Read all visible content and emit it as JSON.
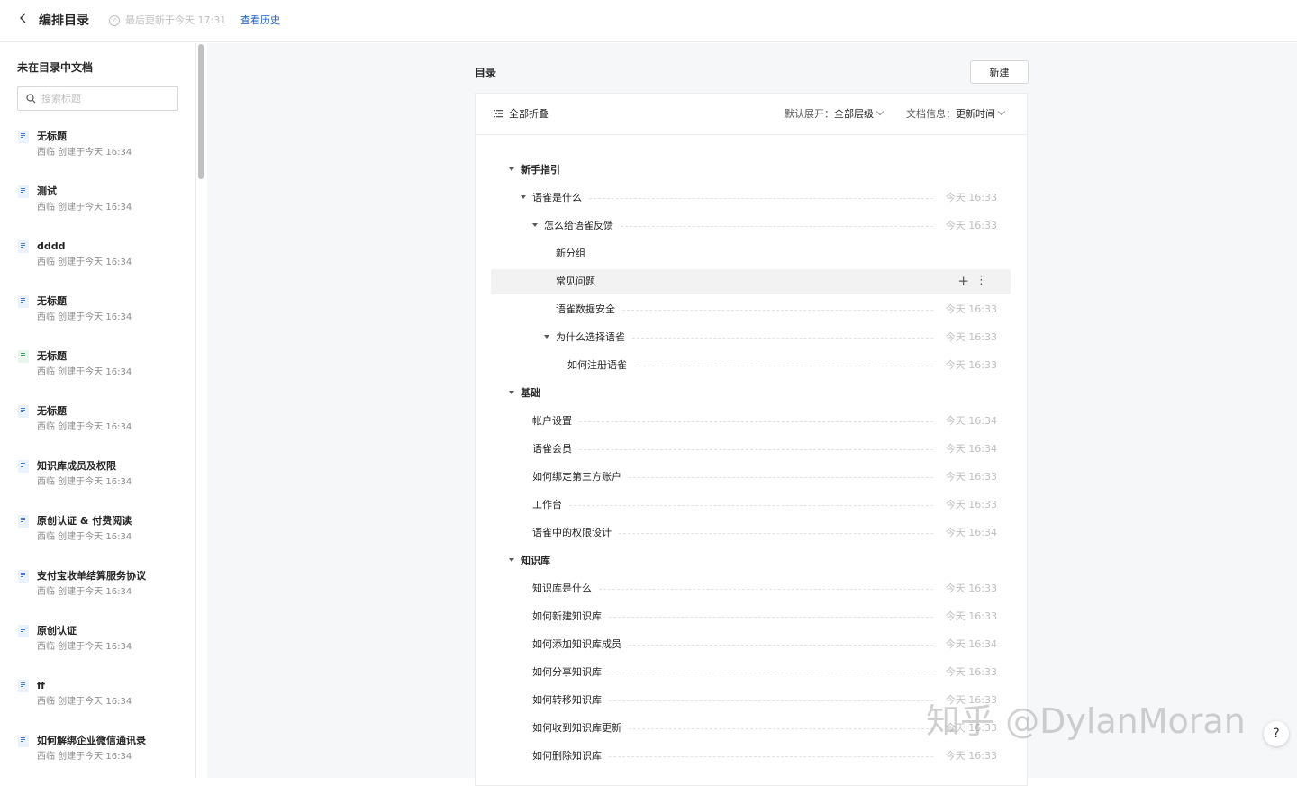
{
  "header": {
    "back_icon": "chevron-left-icon",
    "title": "编排目录",
    "update_status_icon": "check-circle-icon",
    "updated_text": "最后更新于今天 17:31",
    "history_link": "查看历史"
  },
  "sidebar": {
    "title": "未在目录中文档",
    "search_placeholder": "搜索标题",
    "items": [
      {
        "name": "无标题",
        "meta": "西临 创建于今天 16:34",
        "icon": "doc-icon"
      },
      {
        "name": "测试",
        "meta": "西临 创建于今天 16:34",
        "icon": "doc-icon"
      },
      {
        "name": "dddd",
        "meta": "西临 创建于今天 16:34",
        "icon": "doc-icon"
      },
      {
        "name": "无标题",
        "meta": "西临 创建于今天 16:34",
        "icon": "doc-icon"
      },
      {
        "name": "无标题",
        "meta": "西临 创建于今天 16:34",
        "icon": "sheet-icon"
      },
      {
        "name": "无标题",
        "meta": "西临 创建于今天 16:34",
        "icon": "doc-icon"
      },
      {
        "name": "知识库成员及权限",
        "meta": "西临 创建于今天 16:34",
        "icon": "doc-icon"
      },
      {
        "name": "原创认证 & 付费阅读",
        "meta": "西临 创建于今天 16:34",
        "icon": "doc-icon"
      },
      {
        "name": "支付宝收单结算服务协议",
        "meta": "西临 创建于今天 16:34",
        "icon": "doc-icon"
      },
      {
        "name": "原创认证",
        "meta": "西临 创建于今天 16:34",
        "icon": "doc-icon"
      },
      {
        "name": "ff",
        "meta": "西临 创建于今天 16:34",
        "icon": "doc-icon"
      },
      {
        "name": "如何解绑企业微信通讯录",
        "meta": "西临 创建于今天 16:34",
        "icon": "doc-icon"
      }
    ]
  },
  "main": {
    "panel_title": "目录",
    "new_button": "新建",
    "toolbar": {
      "collapse_all": "全部折叠",
      "default_expand_label": "默认展开：",
      "default_expand_value": "全部层级",
      "doc_info_label": "文档信息：",
      "doc_info_value": "更新时间"
    },
    "tree": [
      {
        "label": "新手指引",
        "level": 0,
        "caret": true,
        "group": true,
        "time": ""
      },
      {
        "label": "语雀是什么",
        "level": 1,
        "caret": true,
        "group": false,
        "time": "今天 16:33"
      },
      {
        "label": "怎么给语雀反馈",
        "level": 2,
        "caret": true,
        "group": false,
        "time": "今天 16:33"
      },
      {
        "label": "新分组",
        "level": 3,
        "caret": false,
        "group": false,
        "time": ""
      },
      {
        "label": "常见问题",
        "level": 3,
        "caret": false,
        "group": false,
        "time": "",
        "highlight": true
      },
      {
        "label": "语雀数据安全",
        "level": 3,
        "caret": false,
        "group": false,
        "time": "今天 16:33"
      },
      {
        "label": "为什么选择语雀",
        "level": 3,
        "caret": true,
        "group": false,
        "time": "今天 16:33"
      },
      {
        "label": "如何注册语雀",
        "level": 4,
        "caret": false,
        "group": false,
        "time": "今天 16:33"
      },
      {
        "label": "基础",
        "level": 0,
        "caret": true,
        "group": true,
        "time": ""
      },
      {
        "label": "帐户设置",
        "level": 1,
        "caret": false,
        "group": false,
        "time": "今天 16:34"
      },
      {
        "label": "语雀会员",
        "level": 1,
        "caret": false,
        "group": false,
        "time": "今天 16:34"
      },
      {
        "label": "如何绑定第三方账户",
        "level": 1,
        "caret": false,
        "group": false,
        "time": "今天 16:33"
      },
      {
        "label": "工作台",
        "level": 1,
        "caret": false,
        "group": false,
        "time": "今天 16:33"
      },
      {
        "label": "语雀中的权限设计",
        "level": 1,
        "caret": false,
        "group": false,
        "time": "今天 16:34"
      },
      {
        "label": "知识库",
        "level": 0,
        "caret": true,
        "group": true,
        "time": ""
      },
      {
        "label": "知识库是什么",
        "level": 1,
        "caret": false,
        "group": false,
        "time": "今天 16:33"
      },
      {
        "label": "如何新建知识库",
        "level": 1,
        "caret": false,
        "group": false,
        "time": "今天 16:33"
      },
      {
        "label": "如何添加知识库成员",
        "level": 1,
        "caret": false,
        "group": false,
        "time": "今天 16:34"
      },
      {
        "label": "如何分享知识库",
        "level": 1,
        "caret": false,
        "group": false,
        "time": "今天 16:33"
      },
      {
        "label": "如何转移知识库",
        "level": 1,
        "caret": false,
        "group": false,
        "time": "今天 16:33"
      },
      {
        "label": "如何收到知识库更新",
        "level": 1,
        "caret": false,
        "group": false,
        "time": "今天 16:33"
      },
      {
        "label": "如何删除知识库",
        "level": 1,
        "caret": false,
        "group": false,
        "time": "今天 16:33"
      }
    ],
    "row_add_icon": "plus-icon",
    "row_more_icon": "more-vertical-icon"
  },
  "watermark": "知乎 @DylanMoran",
  "help_button": "?"
}
